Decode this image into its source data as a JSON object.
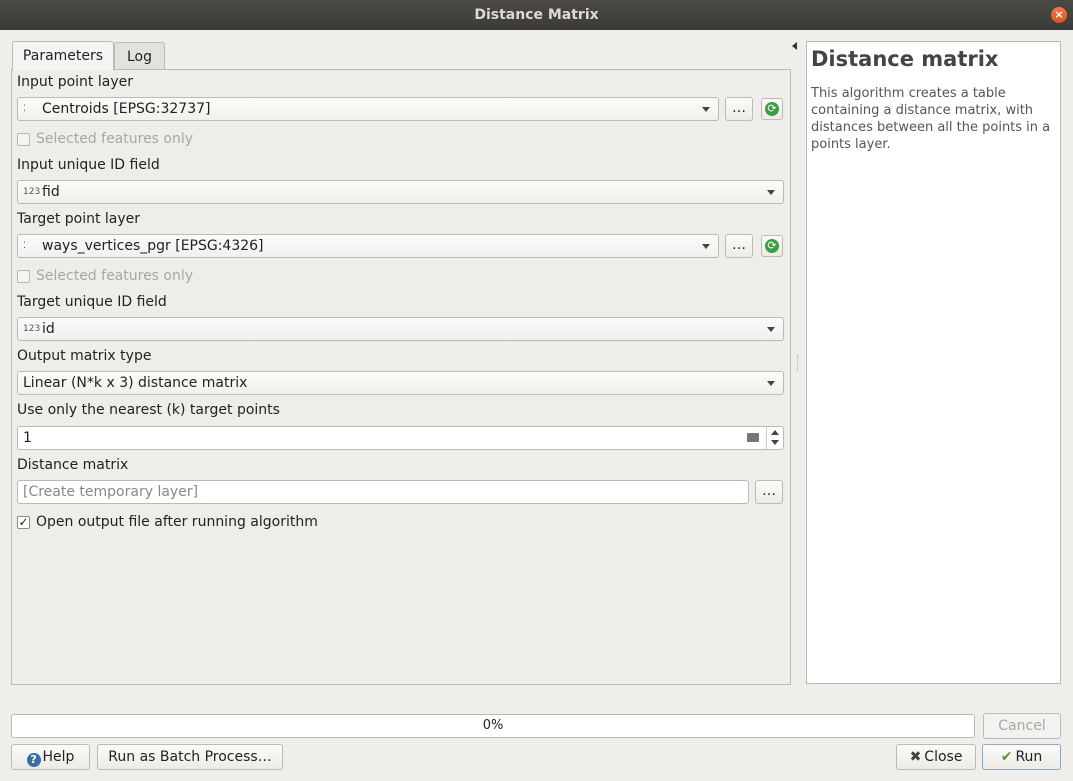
{
  "window": {
    "title": "Distance Matrix",
    "close_glyph": "×"
  },
  "tabs": [
    {
      "label": "Parameters"
    },
    {
      "label": "Log"
    }
  ],
  "params": {
    "input_point_layer": {
      "label": "Input point layer",
      "value": "Centroids [EPSG:32737]",
      "more": "…"
    },
    "input_selected_only": {
      "label": "Selected features only",
      "checked": false
    },
    "input_id_field": {
      "label": "Input unique ID field",
      "icon_text": "123",
      "value": "fid"
    },
    "target_point_layer": {
      "label": "Target point layer",
      "value": "ways_vertices_pgr [EPSG:4326]",
      "more": "…"
    },
    "target_selected_only": {
      "label": "Selected features only",
      "checked": false
    },
    "target_id_field": {
      "label": "Target unique ID field",
      "icon_text": "123",
      "value": "id"
    },
    "matrix_type": {
      "label": "Output matrix type",
      "value": "Linear (N*k x 3) distance matrix"
    },
    "nearest_k": {
      "label": "Use only the nearest (k) target points",
      "value": "1"
    },
    "distance_matrix": {
      "label": "Distance matrix",
      "placeholder": "[Create temporary layer]",
      "more": "…"
    },
    "open_output": {
      "label": "Open output file after running algorithm",
      "checked": true,
      "check_glyph": "✓"
    }
  },
  "help": {
    "title": "Distance matrix",
    "text": "This algorithm creates a table containing a distance matrix, with distances between all the points in a points layer."
  },
  "progress": {
    "value": 0,
    "label": "0%"
  },
  "buttons": {
    "cancel": "Cancel",
    "help": "Help",
    "help_icon": "?",
    "batch": "Run as Batch Process…",
    "close": "Close",
    "close_icon": "✖",
    "run": "Run",
    "run_icon": "✔"
  },
  "colors": {
    "accent": "#3f9d3f",
    "progress_fill": "#6aa1d8",
    "titlebar": "#3c3b37"
  }
}
